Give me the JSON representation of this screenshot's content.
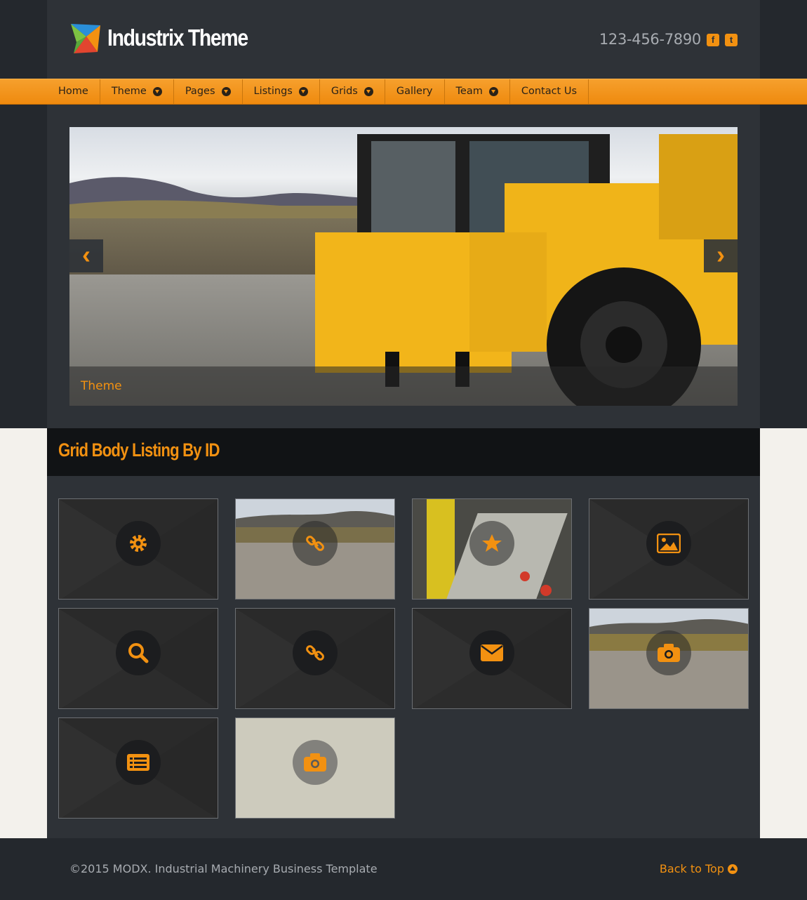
{
  "header": {
    "site_title": "Industrix Theme",
    "phone": "123-456-7890",
    "social": [
      {
        "name": "facebook-icon",
        "glyph": "f"
      },
      {
        "name": "twitter-icon",
        "glyph": "t"
      }
    ]
  },
  "nav": {
    "items": [
      {
        "label": "Home",
        "dropdown": false
      },
      {
        "label": "Theme",
        "dropdown": true
      },
      {
        "label": "Pages",
        "dropdown": true
      },
      {
        "label": "Listings",
        "dropdown": true
      },
      {
        "label": "Grids",
        "dropdown": true
      },
      {
        "label": "Gallery",
        "dropdown": false
      },
      {
        "label": "Team",
        "dropdown": true
      },
      {
        "label": "Contact Us",
        "dropdown": false
      }
    ]
  },
  "slider": {
    "caption": "Theme",
    "prev_glyph": "‹",
    "next_glyph": "›"
  },
  "grid": {
    "title": "Grid Body Listing By ID",
    "tiles": [
      {
        "icon": "gear-icon",
        "background": "pattern"
      },
      {
        "icon": "link-icon",
        "background": "photo-landscape"
      },
      {
        "icon": "star-icon",
        "background": "photo-machine"
      },
      {
        "icon": "image-icon",
        "background": "pattern"
      },
      {
        "icon": "search-icon",
        "background": "pattern"
      },
      {
        "icon": "link-icon",
        "background": "pattern"
      },
      {
        "icon": "envelope-icon",
        "background": "pattern"
      },
      {
        "icon": "camera-icon",
        "background": "photo-landscape"
      },
      {
        "icon": "list-icon",
        "background": "pattern"
      },
      {
        "icon": "camera-icon",
        "background": "photo-sky"
      }
    ]
  },
  "footer": {
    "copyright": "©2015 MODX. Industrial Machinery Business Template",
    "back_to_top": "Back to Top"
  },
  "colors": {
    "accent": "#f29111",
    "dark_bg": "#24282d",
    "panel_bg": "#2e3237",
    "light_bg": "#f3f1ec"
  }
}
